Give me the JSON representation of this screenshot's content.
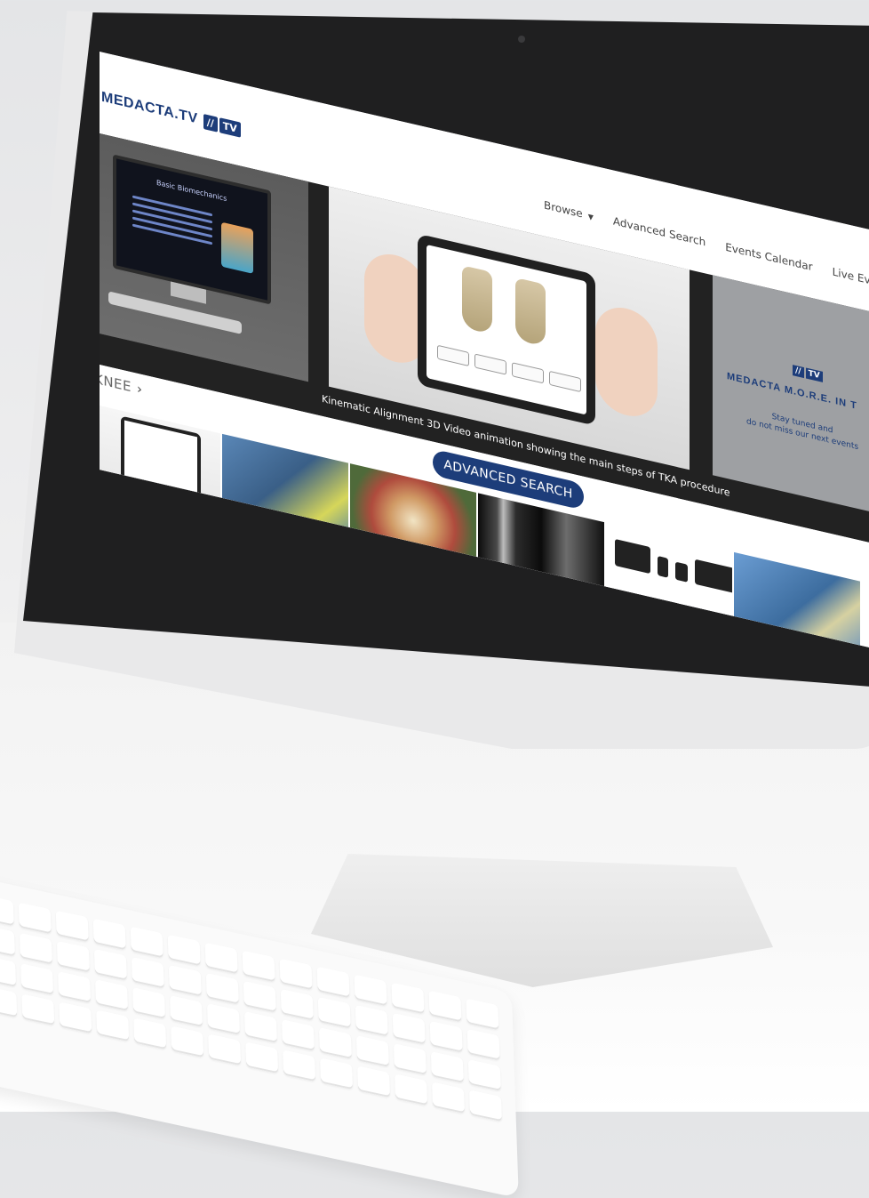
{
  "site": {
    "logo_text": "MEDACTA.TV",
    "logo_badge_a": "//",
    "logo_badge_b": "TV"
  },
  "nav": {
    "items": [
      {
        "label": "Browse",
        "has_caret": true
      },
      {
        "label": "Advanced Search"
      },
      {
        "label": "Events Calendar"
      },
      {
        "label": "Live Eve"
      }
    ],
    "caret_icon": "chevron-down-icon"
  },
  "hero": {
    "slide_a": {
      "mini_title": "Basic Biomechanics"
    },
    "slide_c": {
      "logo_badge_a": "//",
      "logo_badge_b": "TV",
      "title": "MEDACTA M.O.R.E. IN T",
      "subtitle_line1": "Stay tuned and",
      "subtitle_line2": "do not miss our next events"
    },
    "caption": "Kinematic Alignment 3D Video animation showing the main steps of TKA procedure"
  },
  "section": {
    "title": "KNEE",
    "arrow": "›",
    "advanced_search_label": "ADVANCED SEARCH",
    "prev_arrow": "‹"
  },
  "colors": {
    "brand": "#1d3d7a",
    "hero_bg": "#222222",
    "bezel": "#1f1f20"
  }
}
